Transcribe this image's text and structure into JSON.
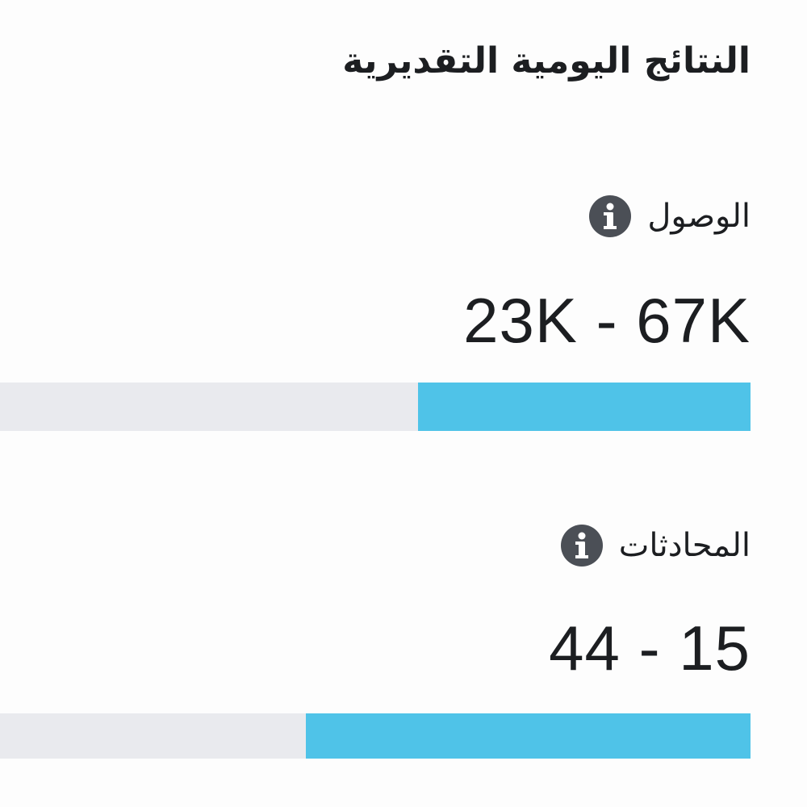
{
  "title": "النتائج اليومية التقديرية",
  "colors": {
    "accent": "#4fc3e8",
    "track": "#e9eaee",
    "icon": "#4b4f56"
  },
  "metrics": [
    {
      "label": "الوصول",
      "icon": "info-icon",
      "value": "23K - 67K",
      "fill_fraction": 0.443
    },
    {
      "label": "المحادثات",
      "icon": "info-icon",
      "value": "44 - 15",
      "fill_fraction": 0.592
    }
  ]
}
